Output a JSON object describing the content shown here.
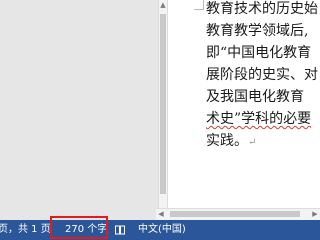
{
  "document": {
    "lines": [
      "教育技术的历史始",
      "教育教学领域后,",
      "即“中国电化教育",
      "展阶段的史实、对",
      "及我国电化教育",
      "术史”学科的必要",
      "实践。"
    ],
    "paragraph_mark": "↵"
  },
  "status_bar": {
    "page_info": "页，共 1 页",
    "word_count": "270 个字",
    "language": "中文(中国)"
  },
  "colors": {
    "status_bar": "#2b579a",
    "highlight_box": "#e21b1b",
    "spellcheck": "#d23b3b"
  }
}
